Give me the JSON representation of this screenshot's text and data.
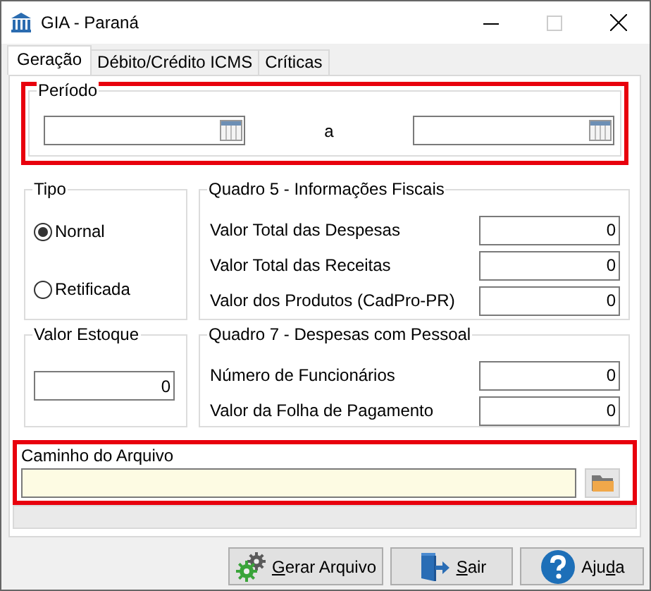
{
  "window": {
    "title": "GIA - Paraná"
  },
  "tabs": [
    {
      "label": "Geração",
      "selected": true
    },
    {
      "label": "Débito/Crédito ICMS",
      "selected": false
    },
    {
      "label": "Críticas",
      "selected": false
    }
  ],
  "periodo": {
    "legend": "Período",
    "separator": "a",
    "highlighted": true
  },
  "tipo": {
    "legend": "Tipo",
    "options": [
      {
        "label": "Nornal",
        "selected": true
      },
      {
        "label": "Retificada",
        "selected": false
      }
    ]
  },
  "quadro5": {
    "legend": "Quadro 5 - Informações Fiscais",
    "fields": [
      {
        "label": "Valor Total das Despesas",
        "value": "0"
      },
      {
        "label": "Valor Total das Receitas",
        "value": "0"
      },
      {
        "label": "Valor dos Produtos (CadPro-PR)",
        "value": "0"
      }
    ]
  },
  "valor_estoque": {
    "legend": "Valor Estoque",
    "value": "0"
  },
  "quadro7": {
    "legend": "Quadro 7 - Despesas com Pessoal",
    "fields": [
      {
        "label": "Número de Funcionários",
        "value": "0"
      },
      {
        "label": "Valor da Folha de Pagamento",
        "value": "0"
      }
    ]
  },
  "caminho": {
    "label": "Caminho do Arquivo",
    "highlighted": true
  },
  "buttons": [
    {
      "kind": "generate",
      "key": "G",
      "label_end": "erar Arquivo"
    },
    {
      "kind": "exit",
      "key": "S",
      "label_end": "air"
    },
    {
      "kind": "help",
      "label_start": "Aju",
      "key": "d",
      "label_end": "a"
    }
  ]
}
